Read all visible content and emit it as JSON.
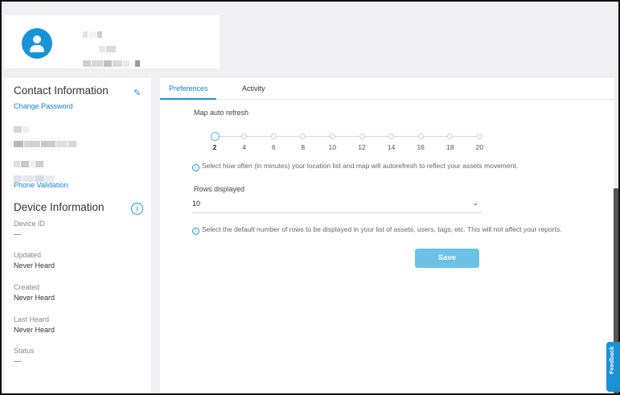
{
  "contact": {
    "title": "Contact Information",
    "change_password": "Change Password",
    "phone_validation": "Phone Validation"
  },
  "device": {
    "title": "Device Information",
    "fields": [
      {
        "label": "Device ID",
        "value": "---"
      },
      {
        "label": "Updated",
        "value": "Never Heard"
      },
      {
        "label": "Created",
        "value": "Never Heard"
      },
      {
        "label": "Last Heard",
        "value": "Never Heard"
      },
      {
        "label": "Status",
        "value": "---"
      }
    ]
  },
  "tabs": [
    {
      "label": "Preferences",
      "active": true
    },
    {
      "label": "Activity",
      "active": false
    }
  ],
  "map_refresh": {
    "label": "Map auto refresh",
    "ticks": [
      "2",
      "4",
      "6",
      "8",
      "10",
      "12",
      "14",
      "16",
      "18",
      "20"
    ],
    "selected": "2",
    "help": "Select how often (in minutes) your location list and map will autorefresh to reflect your assets movement."
  },
  "rows": {
    "label": "Rows displayed",
    "value": "10",
    "help": "Select the default number of rows to be displayed in your list of assets, users, tags, etc. This will not affect your reports."
  },
  "save_label": "Save",
  "feedback_label": "Feedback",
  "colors": {
    "accent": "#1a93d6",
    "save": "#6cc1e7"
  }
}
